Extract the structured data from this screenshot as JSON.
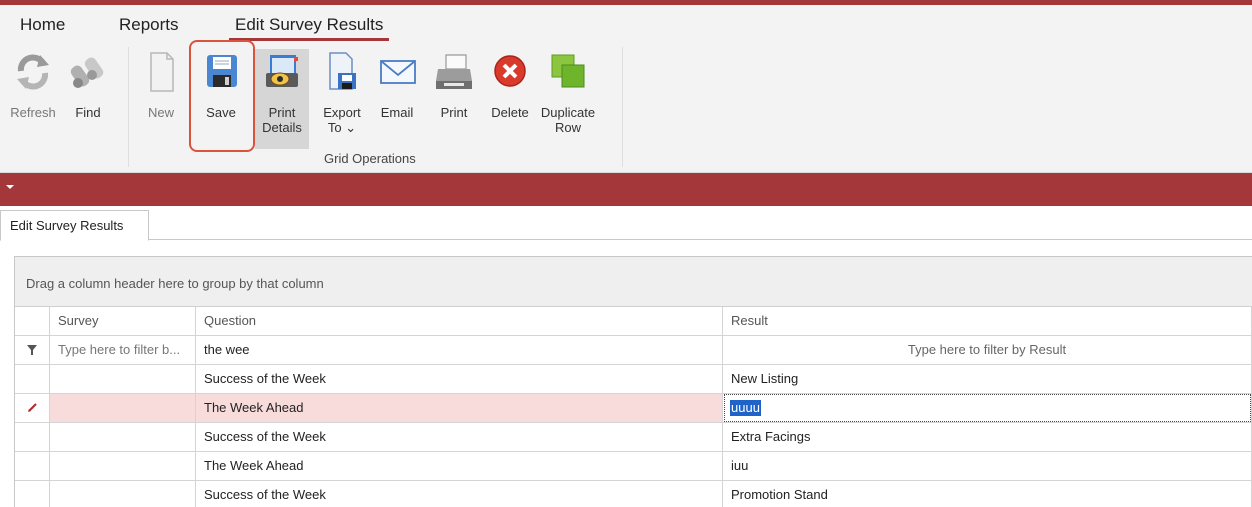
{
  "ribbon": {
    "tabs": [
      "Home",
      "Reports",
      "Edit Survey Results"
    ],
    "active_tab": "Edit Survey Results",
    "buttons": {
      "refresh": "Refresh",
      "find": "Find",
      "new": "New",
      "save": "Save",
      "print_details": "Print\nDetails",
      "export_to": "Export\nTo ⌄",
      "email": "Email",
      "print": "Print",
      "delete": "Delete",
      "duplicate_row": "Duplicate\nRow"
    },
    "group_label": "Grid Operations"
  },
  "document_tab": "Edit Survey Results",
  "grid": {
    "group_panel_text": "Drag a column header here to group by that column",
    "columns": [
      "Survey",
      "Question",
      "Result"
    ],
    "filter": {
      "survey_placeholder": "Type here to filter b...",
      "question_value": "the wee",
      "result_placeholder": "Type here to filter by Result"
    },
    "rows": [
      {
        "survey": "",
        "question": "Success of the Week",
        "result": "New Listing"
      },
      {
        "survey": "",
        "question": "The Week Ahead",
        "result": "uuuu"
      },
      {
        "survey": "",
        "question": "Success of the Week",
        "result": "Extra Facings"
      },
      {
        "survey": "",
        "question": "The Week Ahead",
        "result": "iuu"
      },
      {
        "survey": "",
        "question": "Success of the Week",
        "result": "Promotion Stand"
      }
    ]
  },
  "colors": {
    "accent": "#a4373a",
    "save_highlight": "#d9533d",
    "selection": "#1f63c9",
    "focused_row": "#f8dcdc"
  }
}
